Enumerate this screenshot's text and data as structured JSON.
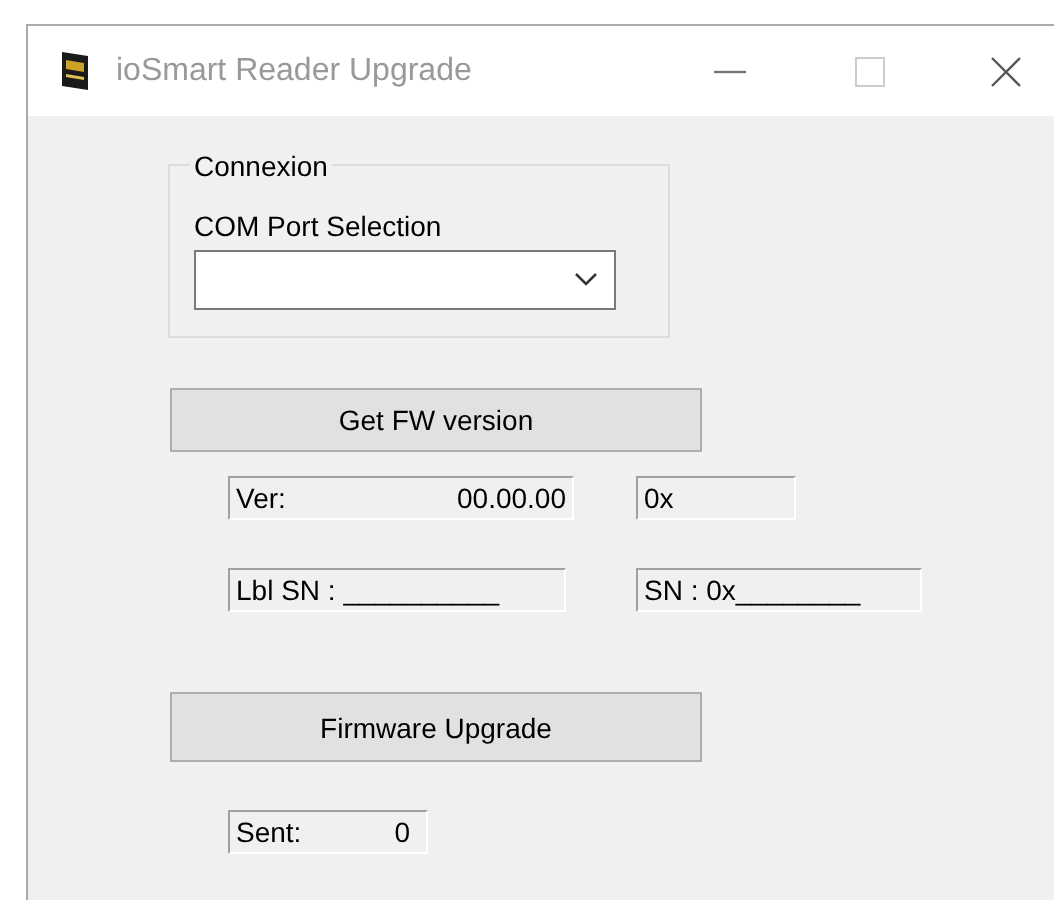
{
  "window": {
    "title": "ioSmart Reader Upgrade"
  },
  "connexion": {
    "title": "Connexion",
    "port_label": "COM Port Selection"
  },
  "get_version_button": "Get FW version",
  "readout_rows": [
    [
      {
        "label": "Ver:",
        "value": "00.00.00",
        "kind": "wide"
      },
      {
        "label": "0x",
        "kind": "short"
      }
    ],
    [
      {
        "label": "Lbl SN : __________",
        "kind": "wide"
      },
      {
        "label": "SN : 0x________",
        "kind": "long"
      }
    ]
  ],
  "upgrade_button": "Firmware Upgrade",
  "sent": {
    "label": "Sent:",
    "value": "0"
  }
}
